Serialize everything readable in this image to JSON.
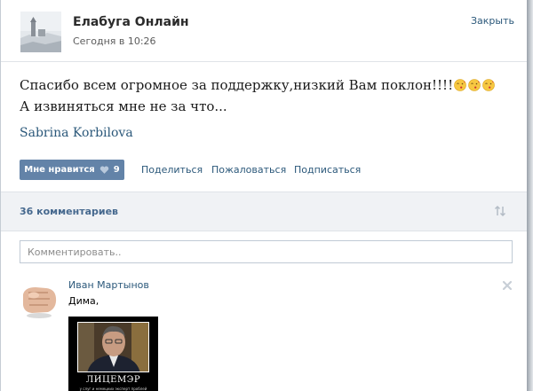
{
  "post": {
    "group_name": "Елабуга Онлайн",
    "time": "Сегодня в 10:26",
    "close_label": "Закрыть",
    "text_main": "Спасибо всем огромное за поддержку,низкий Вам поклон!!!!",
    "text_tail": " А извиняться мне не за что...",
    "emoji_name": "kissing-face-emoji",
    "emoji_count": 3,
    "author_sign": "Sabrina Korbilova"
  },
  "actions": {
    "like_label": "Мне нравится",
    "like_count": "9",
    "share_label": "Поделиться",
    "report_label": "Пожаловаться",
    "subscribe_label": "Подписаться"
  },
  "comments": {
    "count_label": "36 комментариев",
    "input_placeholder": "Комментировать..",
    "items": [
      {
        "author": "Иван Мартынов",
        "text": "Дима,",
        "attachment_caption": "ЛИЦЕМЭР",
        "attachment_subcaption": "у слуг и немецких эксперт проблей"
      }
    ]
  },
  "colors": {
    "link": "#2b587a",
    "like_button": "#6383a8",
    "comments_bar": "#f0f2f5",
    "count_text": "#45688e"
  }
}
